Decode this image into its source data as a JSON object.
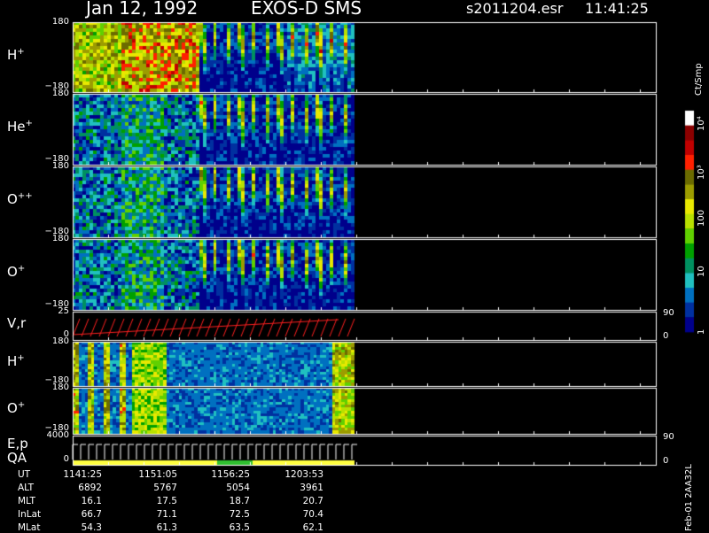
{
  "header": {
    "date": "Jan 12, 1992",
    "instrument": "EXOS-D SMS",
    "file": "s2011204.esr",
    "time": "11:41:25"
  },
  "panels": [
    {
      "label": "H",
      "sup": "+",
      "ymax": "180",
      "ymin": "−180"
    },
    {
      "label": "He",
      "sup": "+",
      "ymax": "180",
      "ymin": "−180"
    },
    {
      "label": "O",
      "sup": "++",
      "ymax": "180",
      "ymin": "−180"
    },
    {
      "label": "O",
      "sup": "+",
      "ymax": "180",
      "ymin": "−180"
    },
    {
      "label": "V,r",
      "sup": "",
      "ymax": "25",
      "ymin": "0",
      "right_top": "90",
      "right_bottom": "0"
    },
    {
      "label": "H",
      "sup": "+",
      "ymax": "180",
      "ymin": "−180"
    },
    {
      "label": "O",
      "sup": "+",
      "ymax": "180",
      "ymin": "−180"
    },
    {
      "label": "E,p",
      "label2": "QA",
      "sup": "",
      "ymax": "4000",
      "ymin": "0",
      "right_top": "90",
      "right_bottom": "0"
    }
  ],
  "colorbar": {
    "unit": "Ct/Smp",
    "ticks": [
      "10⁴",
      "10³",
      "100",
      "10",
      "1"
    ],
    "colors": [
      "#ffffff",
      "#8b0000",
      "#c00000",
      "#ff2000",
      "#6b6b00",
      "#9c9c00",
      "#e8e800",
      "#b8e000",
      "#60d000",
      "#00a000",
      "#009060",
      "#20c0c0",
      "#0070c0",
      "#0030a0",
      "#00008b"
    ]
  },
  "footer": {
    "labels": [
      "UT",
      "ALT",
      "MLT",
      "InLat",
      "MLat"
    ],
    "columns": [
      [
        "1141:25",
        "6892",
        "16.1",
        "66.7",
        "54.3"
      ],
      [
        "1151:05",
        "5767",
        "17.5",
        "71.1",
        "61.3"
      ],
      [
        "1156:25",
        "5054",
        "18.7",
        "72.5",
        "63.5"
      ],
      [
        "1203:53",
        "3961",
        "20.7",
        "70.4",
        "62.1"
      ]
    ],
    "footnote": "Feb-01 2AA32L"
  },
  "chart_data": {
    "type": "heatmap",
    "panels": [
      "H+",
      "He+",
      "O++",
      "O+",
      "V,r",
      "H+",
      "O+",
      "E,p / QA"
    ],
    "x": [
      "1141:25",
      "1151:05",
      "1156:25",
      "1203:53"
    ],
    "y_range_angle": [
      -180,
      180
    ],
    "colorbar_unit": "Ct/Smp",
    "colorbar_scale": "log",
    "colorbar_range": [
      1,
      10000
    ],
    "qa_colors": [
      "#ffff40",
      "#30c030"
    ]
  }
}
